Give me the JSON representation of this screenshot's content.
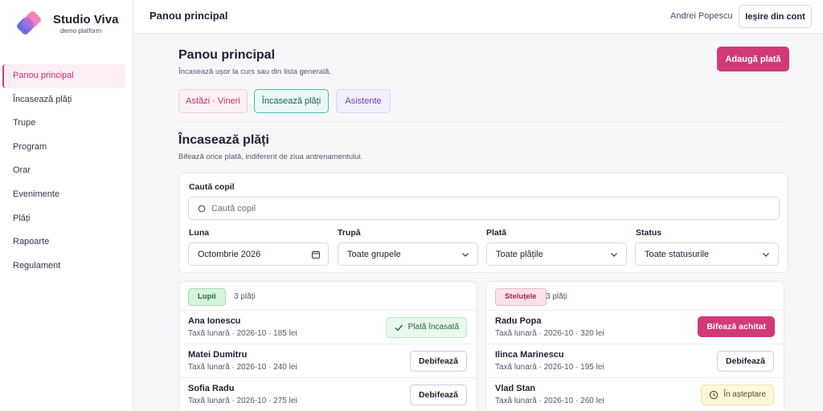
{
  "brand": {
    "title": "Studio Viva",
    "subtitle": "demo platform"
  },
  "sidebar": {
    "items": [
      {
        "label": "Panou principal",
        "active": true
      },
      {
        "label": "Încasează plăți"
      },
      {
        "label": "Trupe"
      },
      {
        "label": "Program"
      },
      {
        "label": "Orar"
      },
      {
        "label": "Evenimente"
      },
      {
        "label": "Plăți"
      },
      {
        "label": "Rapoarte"
      },
      {
        "label": "Regulament"
      }
    ]
  },
  "topbar": {
    "title": "Panou principal",
    "user": "Andrei Popescu",
    "logout_label": "Ieșire din cont"
  },
  "main": {
    "heading": "Panou principal",
    "subheading": "Încasează ușor la curs sau din lista generală.",
    "add_payment_label": "Adaugă plată",
    "chips": [
      "Astăzi · Vineri",
      "Încasează plăți",
      "Asistente"
    ],
    "section_title": "Încasează plăți",
    "section_subtitle": "Bifează orice plată, indiferent de ziua antrenamentului."
  },
  "filters": {
    "search_label": "Caută copil",
    "search_placeholder": "Caută copil",
    "month_label": "Luna",
    "month_value": "Octombrie  2026",
    "group_label": "Trupă",
    "group_value": "Toate grupele",
    "payment_label": "Plată",
    "payment_value": "Toate plățile",
    "status_label": "Status",
    "status_value": "Toate statusurile"
  },
  "groups": [
    {
      "name": "Lupii",
      "count": "3 plăți",
      "rows": [
        {
          "name": "Ana Ionescu",
          "detail": "Taxă lunară · 2026-10 · 185 lei",
          "status": "Plată încasată"
        },
        {
          "name": "Matei Dumitru",
          "detail": "Taxă lunară · 2026-10 · 240 lei",
          "action": "Debifează"
        },
        {
          "name": "Sofia Radu",
          "detail": "Taxă lunară · 2026-10 · 275 lei",
          "action": "Debifează"
        }
      ]
    },
    {
      "name": "Steluțele",
      "count": "3 plăți",
      "rows": [
        {
          "name": "Radu Popa",
          "detail": "Taxă lunară · 2026-10 · 320 lei",
          "action": "Bifează achitat"
        },
        {
          "name": "Ilinca Marinescu",
          "detail": "Taxă lunară · 2026-10 · 195 lei",
          "action": "Debifează"
        },
        {
          "name": "Vlad Stan",
          "detail": "Taxă lunară · 2026-10 · 260 lei",
          "status": "În așteptare"
        }
      ]
    }
  ],
  "colors": {
    "accent": "#d13a76",
    "teal": "#56b8ad",
    "success": "#1f6a38",
    "warning": "#5a4a14"
  }
}
